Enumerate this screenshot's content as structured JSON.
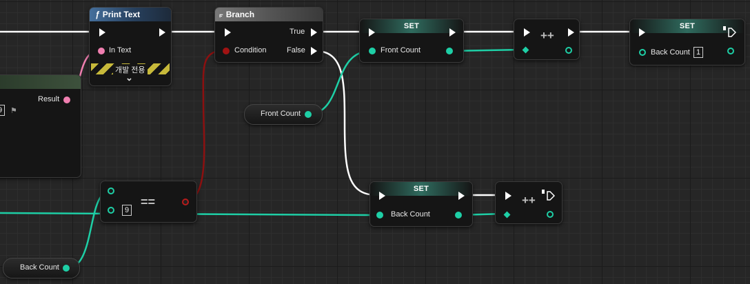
{
  "graph": {
    "print_text": {
      "title": "Print Text",
      "icon": "ƒ",
      "in_text": "In Text",
      "dev_only": "개발 전용",
      "expand_glyph": "⌄"
    },
    "branch": {
      "title": "Branch",
      "condition": "Condition",
      "true_label": "True",
      "false_label": "False"
    },
    "set_front": {
      "title": "SET",
      "var": "Front Count"
    },
    "incr_top": {
      "op": "++"
    },
    "set_back_top": {
      "title": "SET",
      "var": "Back Count",
      "value": "1"
    },
    "result_node": {
      "result_label": "Result",
      "value": "9"
    },
    "front_count_get": {
      "label": "Front Count"
    },
    "equals": {
      "op": "==",
      "value": "9"
    },
    "set_back_bottom": {
      "title": "SET",
      "var": "Back Count"
    },
    "incr_bottom": {
      "op": "++"
    },
    "back_count_get": {
      "label": "Back Count"
    }
  },
  "colors": {
    "exec_wire": "#ffffff",
    "int_wire": "#1ecfa6",
    "string_wire": "#f07fb0",
    "bool_wire": "#8c1010"
  }
}
